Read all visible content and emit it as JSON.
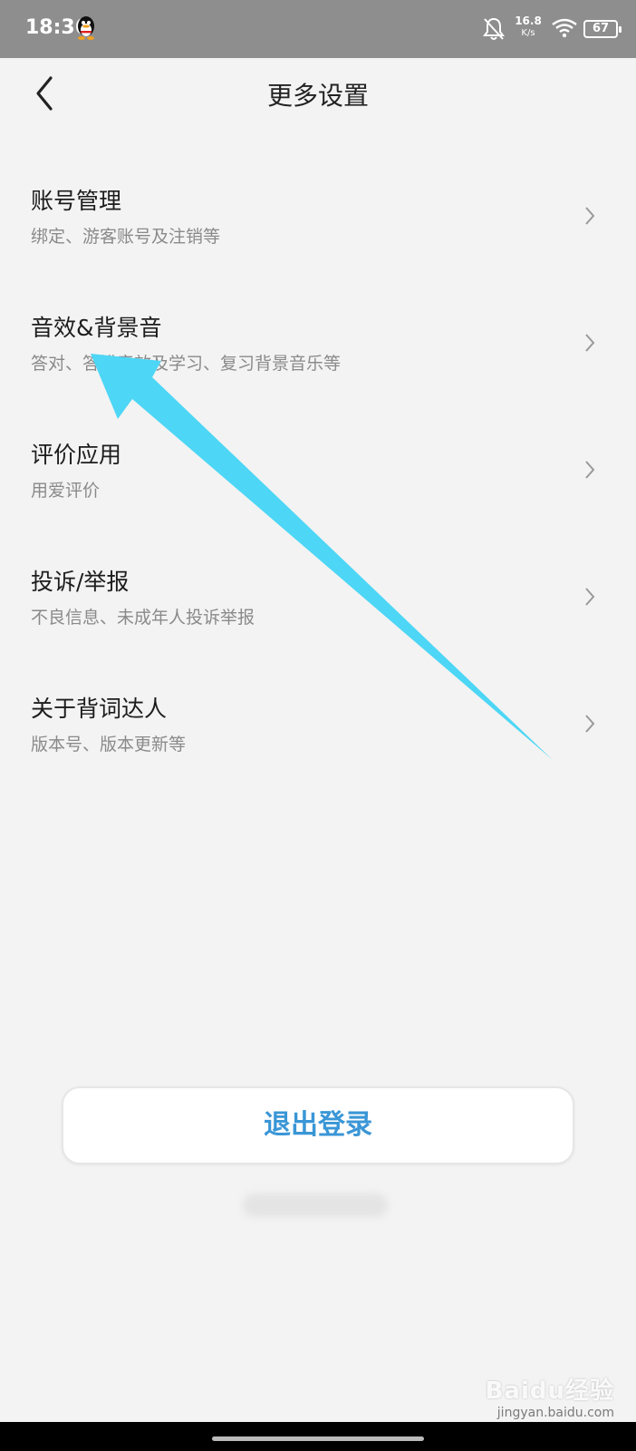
{
  "status_bar": {
    "time": "18:36",
    "net_speed_value": "16.8",
    "net_speed_unit": "K/s",
    "battery": "67",
    "icons": [
      "qq-icon",
      "bell-off-icon",
      "wifi-icon",
      "battery-icon"
    ]
  },
  "header": {
    "title": "更多设置",
    "back_icon": "back-chevron-icon"
  },
  "settings": {
    "items": [
      {
        "title": "账号管理",
        "subtitle": "绑定、游客账号及注销等"
      },
      {
        "title": "音效&背景音",
        "subtitle": "答对、答错音效及学习、复习背景音乐等"
      },
      {
        "title": "评价应用",
        "subtitle": "用爱评价"
      },
      {
        "title": "投诉/举报",
        "subtitle": "不良信息、未成年人投诉举报"
      },
      {
        "title": "关于背词达人",
        "subtitle": "版本号、版本更新等"
      }
    ]
  },
  "footer": {
    "logout_label": "退出登录"
  },
  "watermark": {
    "logo": "Baidu经验",
    "url": "jingyan.baidu.com"
  },
  "colors": {
    "accent": "#3a96d6",
    "annotation_arrow": "#4dd6f5",
    "background": "#f3f3f3",
    "status_bar": "#8e8e8e"
  }
}
